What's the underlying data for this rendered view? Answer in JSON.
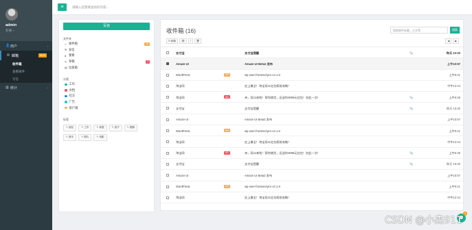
{
  "profile": {
    "name": "admin",
    "status": "在线 ~"
  },
  "nav": {
    "items": [
      {
        "icon": "user-icon",
        "glyph": "👤",
        "label": "用户",
        "chevron": "›"
      },
      {
        "icon": "mail-icon",
        "glyph": "✉",
        "label": "邮箱",
        "badge": "NEW"
      }
    ],
    "sub_items": [
      "收件箱",
      "查看邮件",
      "写信"
    ],
    "stats": {
      "icon": "chart-icon",
      "glyph": "▥",
      "label": "统计",
      "chevron": "›"
    }
  },
  "topbar": {
    "menu_glyph": "≡",
    "search_placeholder": "请输入您需要查找的内容..."
  },
  "side": {
    "compose": "写信",
    "folders_title": "文件夹",
    "folders": [
      {
        "icon": "inbox-icon",
        "glyph": "⌂",
        "label": "收件箱",
        "badge": "16",
        "badge_color": "#f0ad4e"
      },
      {
        "icon": "send-icon",
        "glyph": "✉",
        "label": "发信",
        "badge": "",
        "badge_color": ""
      },
      {
        "icon": "star-icon",
        "glyph": "●",
        "label": "重要",
        "badge": "",
        "badge_color": ""
      },
      {
        "icon": "draft-icon",
        "glyph": "✎",
        "label": "草稿",
        "badge": "2",
        "badge_color": "#ed5565"
      },
      {
        "icon": "trash-icon",
        "glyph": "▤",
        "label": "垃圾箱",
        "badge": "",
        "badge_color": ""
      }
    ],
    "categories_title": "分类",
    "categories": [
      {
        "label": "工作",
        "color": "#1ab394"
      },
      {
        "label": "文档",
        "color": "#ed5565"
      },
      {
        "label": "社交",
        "color": "#1c84c6"
      },
      {
        "label": "广告",
        "color": "#23c6c8"
      },
      {
        "label": "客户端",
        "color": "#f8ac59"
      }
    ],
    "labels_title": "标签",
    "tags": [
      "朋友",
      "工作",
      "家庭",
      "孩子",
      "假期",
      "音乐",
      "照片",
      "电影"
    ]
  },
  "mail": {
    "title": "收件箱 (16)",
    "search_placeholder": "搜索邮件标题，正文等",
    "search_button": "搜索",
    "tools": {
      "refresh": "↻ 刷新",
      "read": "👁",
      "important": "!",
      "delete": "🗑"
    },
    "pager": {
      "prev": "◀",
      "next": "▶"
    },
    "rows": [
      {
        "checked": false,
        "bold": true,
        "hl": false,
        "sender": "支付宝",
        "label": "",
        "label_color": "",
        "subject": "支付宝提醒",
        "clip": "📎",
        "time": "昨天 10:20"
      },
      {
        "checked": true,
        "bold": true,
        "hl": true,
        "sender": "Amaze UI",
        "label": "",
        "label_color": "",
        "subject": "Amaze UI Beta2 发布",
        "clip": "",
        "time": "上午10:57"
      },
      {
        "checked": false,
        "bold": false,
        "hl": false,
        "sender": "WordPress",
        "label": "VIP",
        "label_color": "#f8ac59",
        "subject": "wp-user-frontend-pro v2.1.9",
        "clip": "",
        "time": "上午9:21"
      },
      {
        "checked": false,
        "bold": false,
        "hl": false,
        "sender": "淘宝网",
        "label": "",
        "label_color": "",
        "subject": "史上最全！淘宝双11红包疯抢攻略！",
        "clip": "",
        "time": "中午12:24"
      },
      {
        "checked": false,
        "bold": false,
        "hl": false,
        "sender": "淘宝网",
        "label": "AD",
        "label_color": "#ed5565",
        "subject": "亲，双11来啦！帮你挑货，还送你4999元红包！仅此一次！",
        "clip": "📎",
        "time": "上午6:48"
      },
      {
        "checked": false,
        "bold": false,
        "hl": false,
        "sender": "支付宝",
        "label": "",
        "label_color": "",
        "subject": "支付宝提醒",
        "clip": "📎",
        "time": "昨天 10:20"
      },
      {
        "checked": false,
        "bold": false,
        "hl": false,
        "sender": "Amaze UI",
        "label": "",
        "label_color": "",
        "subject": "Amaze UI Beta2 发布",
        "clip": "",
        "time": "上午10:57"
      },
      {
        "checked": false,
        "bold": false,
        "hl": false,
        "sender": "WordPress",
        "label": "VIP",
        "label_color": "#f8ac59",
        "subject": "wp-user-frontend-pro v2.1.9",
        "clip": "",
        "time": "上午9:21"
      },
      {
        "checked": false,
        "bold": false,
        "hl": false,
        "sender": "淘宝网",
        "label": "",
        "label_color": "",
        "subject": "史上最全！淘宝双11红包疯抢攻略！",
        "clip": "",
        "time": "中午12:24"
      },
      {
        "checked": false,
        "bold": false,
        "hl": false,
        "sender": "淘宝网",
        "label": "AD",
        "label_color": "#ed5565",
        "subject": "亲，双11来啦！帮你挑货，还送你4999元红包！仅此一次！",
        "clip": "📎",
        "time": "上午6:48"
      },
      {
        "checked": false,
        "bold": false,
        "hl": false,
        "sender": "支付宝",
        "label": "",
        "label_color": "",
        "subject": "支付宝提醒",
        "clip": "📎",
        "time": "昨天 10:20"
      },
      {
        "checked": false,
        "bold": false,
        "hl": false,
        "sender": "Amaze UI",
        "label": "",
        "label_color": "",
        "subject": "Amaze UI Beta2 发布",
        "clip": "",
        "time": "上午10:57"
      },
      {
        "checked": false,
        "bold": false,
        "hl": false,
        "sender": "WordPress",
        "label": "VIP",
        "label_color": "#f8ac59",
        "subject": "wp-user-frontend-pro v2.1.9",
        "clip": "",
        "time": "上午9:21"
      },
      {
        "checked": false,
        "bold": false,
        "hl": false,
        "sender": "淘宝网",
        "label": "",
        "label_color": "",
        "subject": "史上最全！淘宝双11红包疯抢攻略！",
        "clip": "",
        "time": "中午12:24"
      }
    ]
  },
  "chat": {
    "glyph": "💬",
    "badge": "5"
  },
  "watermark": "CSDN @小杰911"
}
